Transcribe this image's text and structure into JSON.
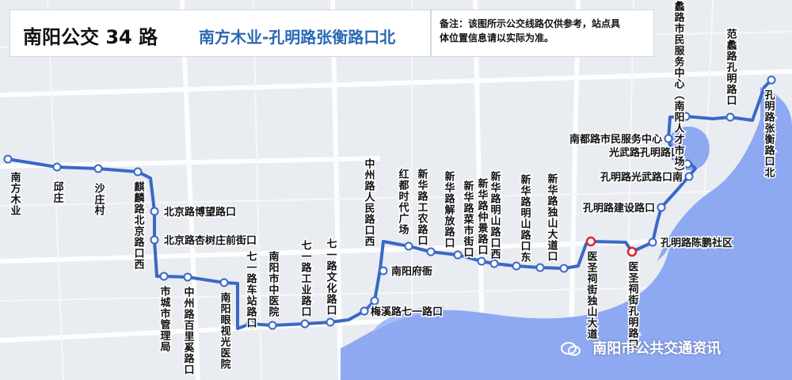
{
  "header": {
    "title": "南阳公交 34 路",
    "subtitle": "南方木业-孔明路张衡路口北"
  },
  "note": {
    "line1": "备注：该图所示公交线路仅供参考，站点具",
    "line2": "体位置信息请以实际为准。"
  },
  "watermark": {
    "text": "南阳市公共交通资讯",
    "icon": "wechat-icon"
  },
  "colors": {
    "route": "#3a68c6",
    "stop_fill": "#ffffff",
    "terminal_ring": "#e0202b",
    "water": "#8ea9f2",
    "road": "#ffffff",
    "map_bg": "#e9ecf1"
  },
  "stops": [
    "南方木业",
    "邱庄",
    "沙庄村",
    "麒麟路北京路口西",
    "北京路博望路口",
    "北京路杏树庄前街口",
    "市城市管理局",
    "中州路百里奚路口",
    "南阳眼视光医院",
    "七一路车站路口",
    "南阳市中医院",
    "七一路工业路口",
    "七一路文化路口",
    "梅溪路七一路口",
    "中州路人民路口西",
    "南阳府衙",
    "红都时代广场",
    "新华路工农路口",
    "新华路解放路口",
    "新华路菜市街口",
    "新华路仲景路口",
    "新华路明山路口西",
    "新华路明山路口东",
    "新华路独山大道口",
    "医圣祠街独山大道",
    "医圣祠街孔明路口",
    "孔明路陈鹏社区",
    "孔明路建设路口",
    "孔明路光武路口南",
    "光武路孔明路口",
    "南都路市民服务中心",
    "范蠡路市民服务中心（南阳人才市场）",
    "范蠡路孔明路口",
    "孔明路张衡路口北"
  ]
}
